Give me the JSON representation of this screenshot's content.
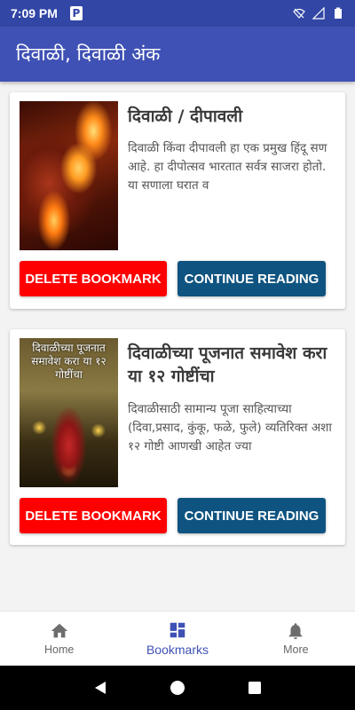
{
  "status_bar": {
    "time": "7:09 PM",
    "notification_icon": "P"
  },
  "app_bar": {
    "title": "दिवाळी, दिवाळी अंक"
  },
  "bookmarks": [
    {
      "title": "दिवाळी / दीपावली",
      "description": "दिवाळी किंवा दीपावली हा एक प्रमुख हिंदू सण आहे. हा दीपोत्सव भारतात सर्वत्र साजरा होतो. या सणाला घरात व",
      "thumbnail_text": "",
      "delete_label": "DELETE BOOKMARK",
      "continue_label": "CONTINUE READING"
    },
    {
      "title": "दिवाळीच्या पूजनात समावेश करा या १२ गोष्टींचा",
      "description": "दिवाळीसाठी सामान्य पूजा साहित्याच्या (दिवा,प्रसाद, कुंकू, फळे, फुले) व्यतिरिक्त अशा १२ गोष्टी आणखी आहेत ज्या",
      "thumbnail_text": "दिवाळीच्या पूजनात समावेश करा या १२ गोष्टींचा",
      "delete_label": "DELETE BOOKMARK",
      "continue_label": "CONTINUE READING"
    }
  ],
  "bottom_nav": {
    "items": [
      {
        "label": "Home",
        "icon": "home-icon",
        "active": false
      },
      {
        "label": "Bookmarks",
        "icon": "bookmarks-icon",
        "active": true
      },
      {
        "label": "More",
        "icon": "bell-icon",
        "active": false
      }
    ]
  },
  "colors": {
    "primary": "#3f51b5",
    "status_bar": "#3246a6",
    "delete": "#ff0000",
    "continue": "#0f5480"
  }
}
